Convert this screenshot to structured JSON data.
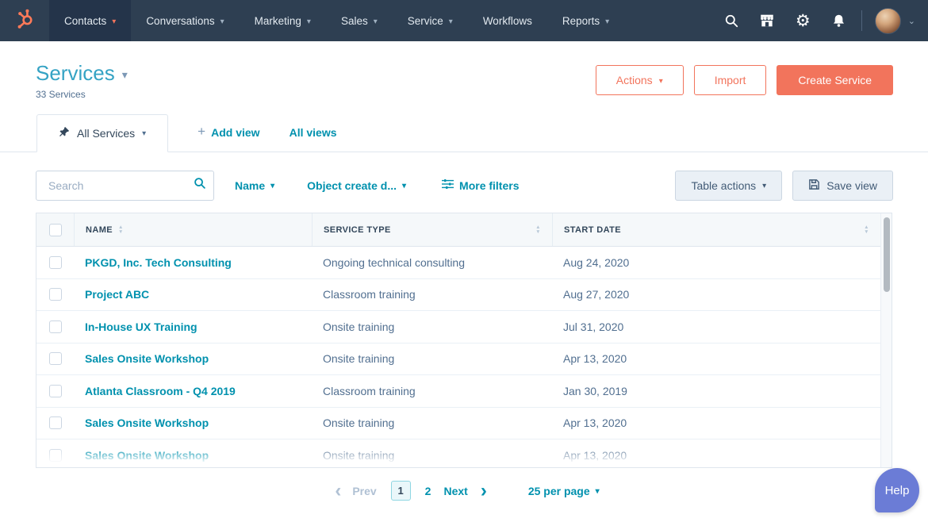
{
  "nav": {
    "items": [
      {
        "label": "Contacts"
      },
      {
        "label": "Conversations"
      },
      {
        "label": "Marketing"
      },
      {
        "label": "Sales"
      },
      {
        "label": "Service"
      },
      {
        "label": "Workflows"
      },
      {
        "label": "Reports"
      }
    ]
  },
  "header": {
    "title": "Services",
    "subtitle": "33 Services",
    "actions_label": "Actions",
    "import_label": "Import",
    "create_label": "Create Service"
  },
  "tabs": {
    "active_label": "All Services",
    "add_view": "Add view",
    "all_views": "All views"
  },
  "filters": {
    "search_placeholder": "Search",
    "name_filter": "Name",
    "date_filter": "Object create d...",
    "more_filters": "More filters",
    "table_actions": "Table actions",
    "save_view": "Save view"
  },
  "table": {
    "columns": [
      "NAME",
      "SERVICE TYPE",
      "START DATE"
    ],
    "rows": [
      {
        "name": "PKGD, Inc. Tech Consulting",
        "type": "Ongoing technical consulting",
        "date": "Aug 24, 2020"
      },
      {
        "name": "Project ABC",
        "type": "Classroom training",
        "date": "Aug 27, 2020"
      },
      {
        "name": "In-House UX Training",
        "type": "Onsite training",
        "date": "Jul 31, 2020"
      },
      {
        "name": "Sales Onsite Workshop",
        "type": "Onsite training",
        "date": "Apr 13, 2020"
      },
      {
        "name": "Atlanta Classroom - Q4 2019",
        "type": "Classroom training",
        "date": "Jan 30, 2019"
      },
      {
        "name": "Sales Onsite Workshop",
        "type": "Onsite training",
        "date": "Apr 13, 2020"
      },
      {
        "name": "Sales Onsite Workshop",
        "type": "Onsite training",
        "date": "Apr 13, 2020"
      }
    ]
  },
  "pagination": {
    "prev": "Prev",
    "page1": "1",
    "page2": "2",
    "next": "Next",
    "per_page": "25 per page"
  },
  "help": {
    "label": "Help"
  },
  "icons": {
    "caret_down": "▾",
    "sort_up": "▲",
    "sort_down": "▼",
    "plus": "+",
    "chevron_left": "‹",
    "chevron_right": "›",
    "avatar_caret": "⌄",
    "gear": "⚙"
  },
  "colors": {
    "nav_bg": "#2e3f52",
    "accent_orange": "#f2745c",
    "link_teal": "#0091ae",
    "navy_text": "#33475b",
    "help_purple": "#6b7cd6"
  }
}
